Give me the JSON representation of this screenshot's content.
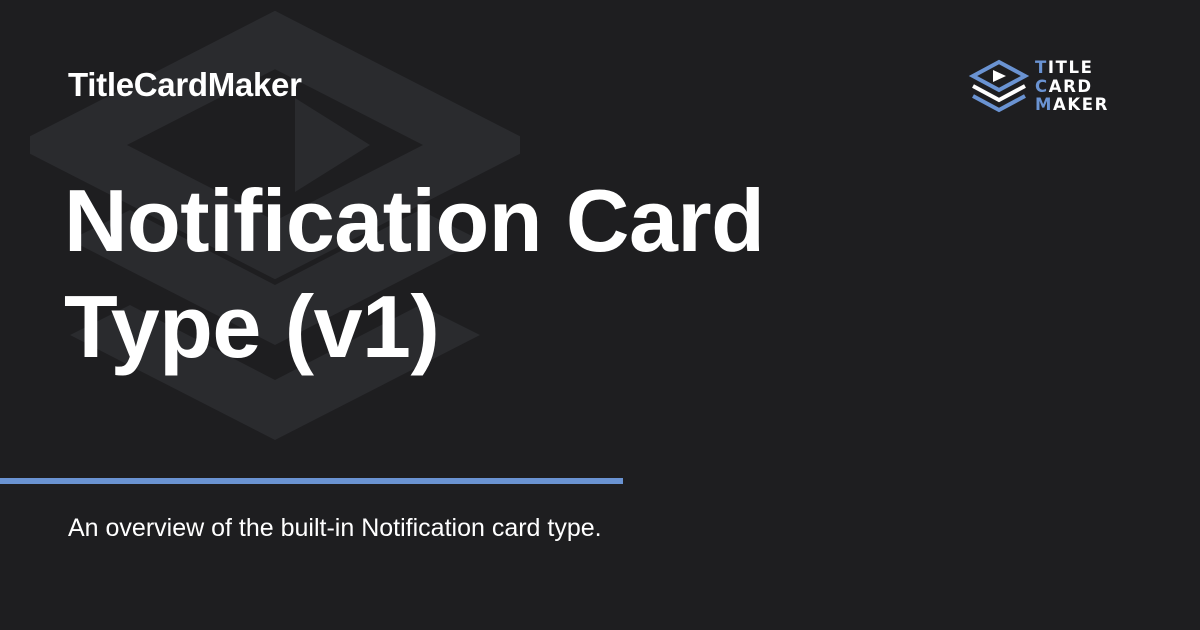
{
  "site": {
    "name": "TitleCardMaker"
  },
  "page": {
    "title_line1": "Notification Card",
    "title_line2": "Type (v1)",
    "description": "An overview of the built-in Notification card type."
  },
  "brand": {
    "line1_accent": "T",
    "line1_rest": "ITLE",
    "line2_accent": "C",
    "line2_rest": "ARD",
    "line3_accent": "M",
    "line3_rest": "AKER"
  },
  "colors": {
    "background": "#1e1e20",
    "accent": "#6a93d2",
    "text": "#ffffff",
    "watermark": "#2b2c2f"
  },
  "icons": {
    "background": "titlecardmaker-watermark-icon",
    "brand": "titlecardmaker-logo-icon"
  }
}
